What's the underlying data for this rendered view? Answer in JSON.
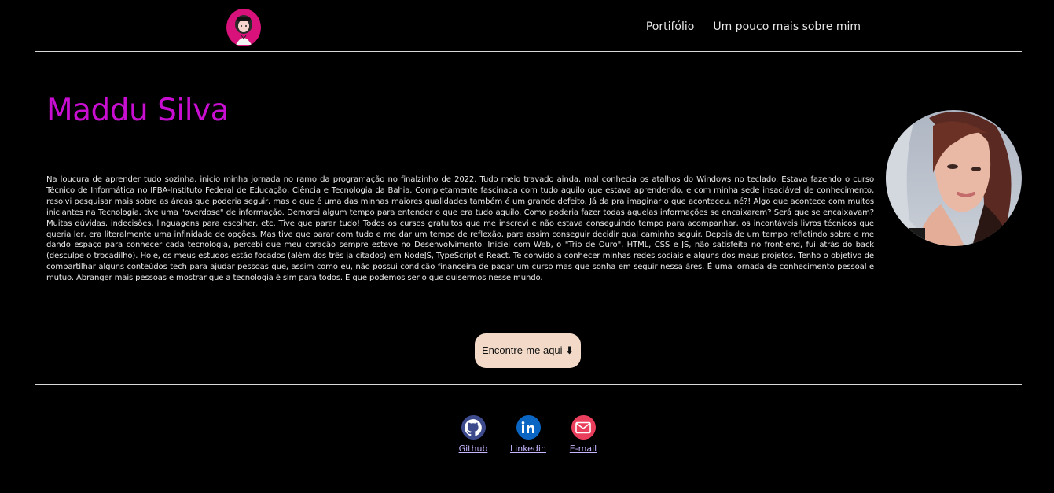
{
  "header": {
    "logo_alt": "avatar logo",
    "nav": [
      {
        "label": "Portifólio"
      },
      {
        "label": "Um pouco mais sobre mim"
      }
    ]
  },
  "main": {
    "title": "Maddu Silva",
    "bio": "Na loucura de aprender tudo sozinha, inicio minha jornada no ramo da programação no finalzinho de 2022. Tudo meio travado ainda, mal conhecia os atalhos do Windows no teclado. Estava fazendo o curso Técnico de Informática no IFBA-Instituto Federal de Educação, Ciência e Tecnologia da Bahia. Completamente fascinada com tudo aquilo que estava aprendendo, e com minha sede insaciável de conhecimento, resolvi pesquisar mais sobre as áreas que poderia seguir, mas o que é uma das minhas maiores qualidades também é um grande defeito. Já da pra imaginar o que aconteceu, né?! Algo que acontece com muitos iniciantes na Tecnologia, tive uma \"overdose\" de informação. Demorei algum tempo para entender o que era tudo aquilo. Como poderia fazer todas aquelas informações se encaixarem? Será que se encaixavam? Muitas dúvidas, indecisões, linguagens para escolher, etc. Tive que parar tudo! Todos os cursos gratuitos que me inscrevi e não estava conseguindo tempo para acompanhar, os incontáveis livros técnicos que queria ler, era literalmente uma infinidade de opções. Mas tive que parar com tudo e me dar um tempo de reflexão, para assim conseguir decidir qual caminho seguir. Depois de um tempo refletindo sobre e me dando espaço para conhecer cada tecnologia, percebi que meu coração sempre esteve no Desenvolvimento. Iniciei com Web, o \"Trio de Ouro\", HTML, CSS e JS, não satisfeita no front-end, fui atrás do back (desculpe o trocadilho). Hoje, os meus estudos estão focados (além dos três ja citados) em NodeJS, TypeScript e React. Te convido a conhecer minhas redes sociais e alguns dos meus projetos. Tenho o objetivo de compartilhar alguns conteúdos tech para ajudar pessoas que, assim como eu, não possui condição financeira de pagar um curso mas que sonha em seguir nessa áres. É uma jornada de conhecimento pessoal e mutuo. Abranger mais pessoas e mostrar que a tecnologia é sim para todos. E que podemos ser o que quisermos nesse mundo.",
    "cta_label": "Encontre-me aqui ⬇"
  },
  "social": [
    {
      "label": "Github",
      "icon": "github-icon",
      "color": "#3d4a8c"
    },
    {
      "label": "Linkedin",
      "icon": "linkedin-icon",
      "color": "#0a66c2"
    },
    {
      "label": "E-mail",
      "icon": "mail-icon",
      "color": "#ea3f5c"
    }
  ],
  "colors": {
    "background": "#000000",
    "accent_title": "#c80ed0",
    "logo_bg": "#d8127a",
    "cta_bg": "#f3dac8",
    "link": "#c7b6ff"
  }
}
